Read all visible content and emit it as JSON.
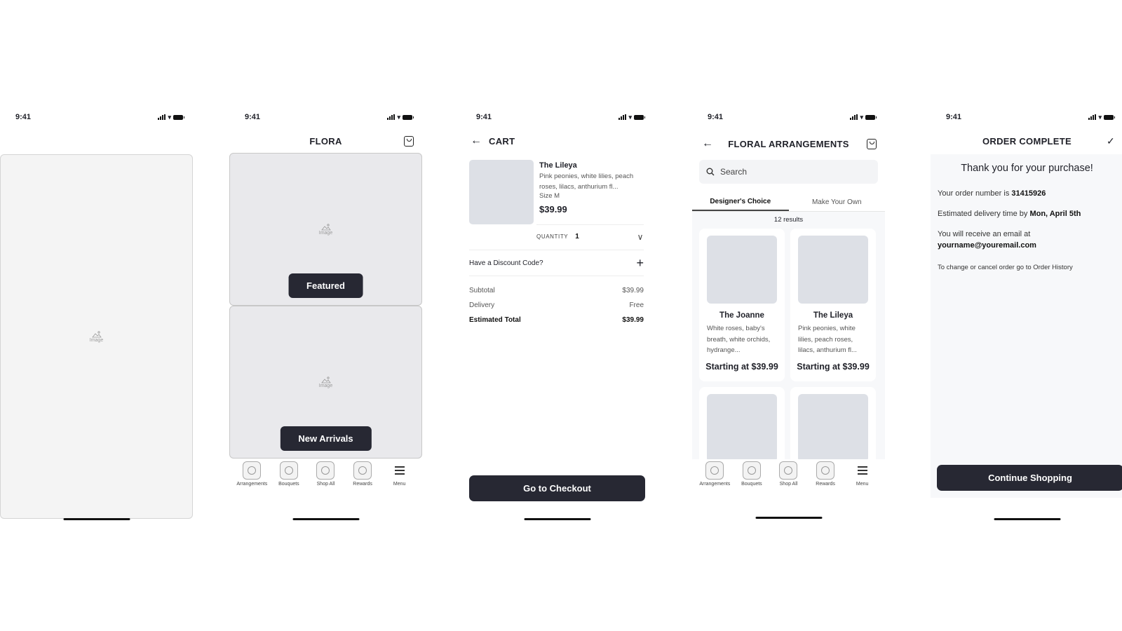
{
  "status_time": "9:41",
  "image_placeholder_label": "Image",
  "screen1": {},
  "screen2": {
    "title": "FLORA",
    "featured_label": "Featured",
    "new_arrivals_label": "New Arrivals",
    "tabbar": [
      "Arrangements",
      "Bouquets",
      "Shop All",
      "Rewards",
      "Menu"
    ]
  },
  "screen3": {
    "title": "CART",
    "item": {
      "name": "The Lileya",
      "description": "Pink peonies, white lilies, peach roses, lilacs, anthurium fl...",
      "size": "Size M",
      "price": "$39.99"
    },
    "quantity_label": "QUANTITY",
    "quantity_value": "1",
    "discount_label": "Have a Discount Code?",
    "summary": [
      {
        "label": "Subtotal",
        "value": "$39.99"
      },
      {
        "label": "Delivery",
        "value": "Free"
      },
      {
        "label": "Estimated Total",
        "value": "$39.99"
      }
    ],
    "checkout_label": "Go to Checkout"
  },
  "screen4": {
    "title": "FLORAL ARRANGEMENTS",
    "search_placeholder": "Search",
    "tabs": [
      "Designer's Choice",
      "Make Your Own"
    ],
    "results": "12 results",
    "products": [
      {
        "name": "The Joanne",
        "description": "White roses, baby's breath, white orchids, hydrange...",
        "price": "Starting at $39.99"
      },
      {
        "name": "The Lileya",
        "description": "Pink peonies, white lilies, peach roses, lilacs, anthurium fl...",
        "price": "Starting at $39.99"
      }
    ],
    "tabbar": [
      "Arrangements",
      "Bouquets",
      "Shop All",
      "Rewards",
      "Menu"
    ]
  },
  "screen5": {
    "title": "ORDER COMPLETE",
    "thank_you": "Thank you for your purchase!",
    "order_prefix": "Your order number is ",
    "order_number": "31415926",
    "delivery_prefix": "Estimated delivery time by ",
    "delivery_date": "Mon, April 5th",
    "email_prefix": "You will receive an email at",
    "email": "yourname@youremail.com",
    "change_note": "To change or cancel order go to Order History",
    "continue_label": "Continue Shopping"
  }
}
